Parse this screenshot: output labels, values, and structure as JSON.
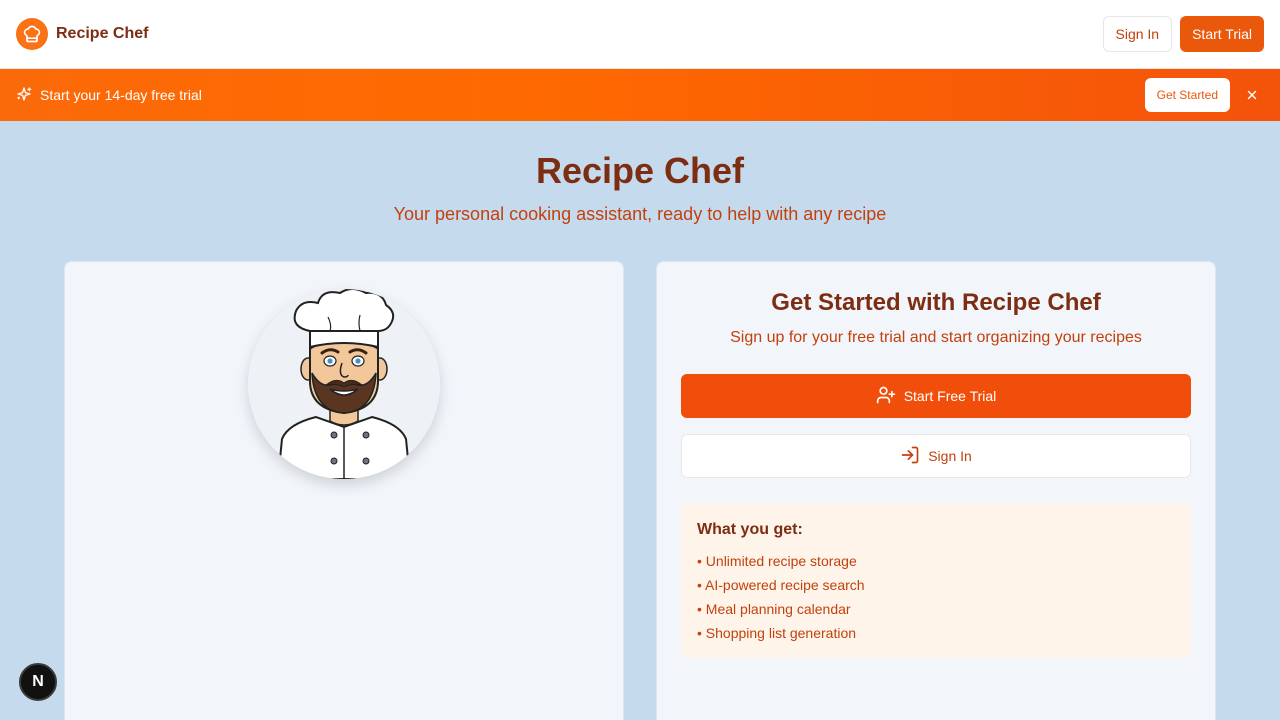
{
  "navbar": {
    "brand_name": "Recipe Chef",
    "sign_in_label": "Sign In",
    "start_trial_label": "Start Trial"
  },
  "banner": {
    "text": "Start your 14-day free trial",
    "cta_label": "Get Started",
    "close_icon": "close-icon"
  },
  "hero": {
    "title": "Recipe Chef",
    "subtitle": "Your personal cooking assistant, ready to help with any recipe"
  },
  "signup_card": {
    "title": "Get Started with Recipe Chef",
    "subtitle": "Sign up for your free trial and start organizing your recipes",
    "trial_button_label": "Start Free Trial",
    "signin_button_label": "Sign In",
    "benefits_title": "What you get:",
    "benefits": [
      "Unlimited recipe storage",
      "AI-powered recipe search",
      "Meal planning calendar",
      "Shopping list generation"
    ]
  },
  "dev_badge": {
    "label": "N"
  },
  "colors": {
    "brand": "#f97316",
    "primary": "#ea580c",
    "heading": "#7c2d12",
    "accent_text": "#c2410c",
    "page_bg": "#c6daee"
  }
}
